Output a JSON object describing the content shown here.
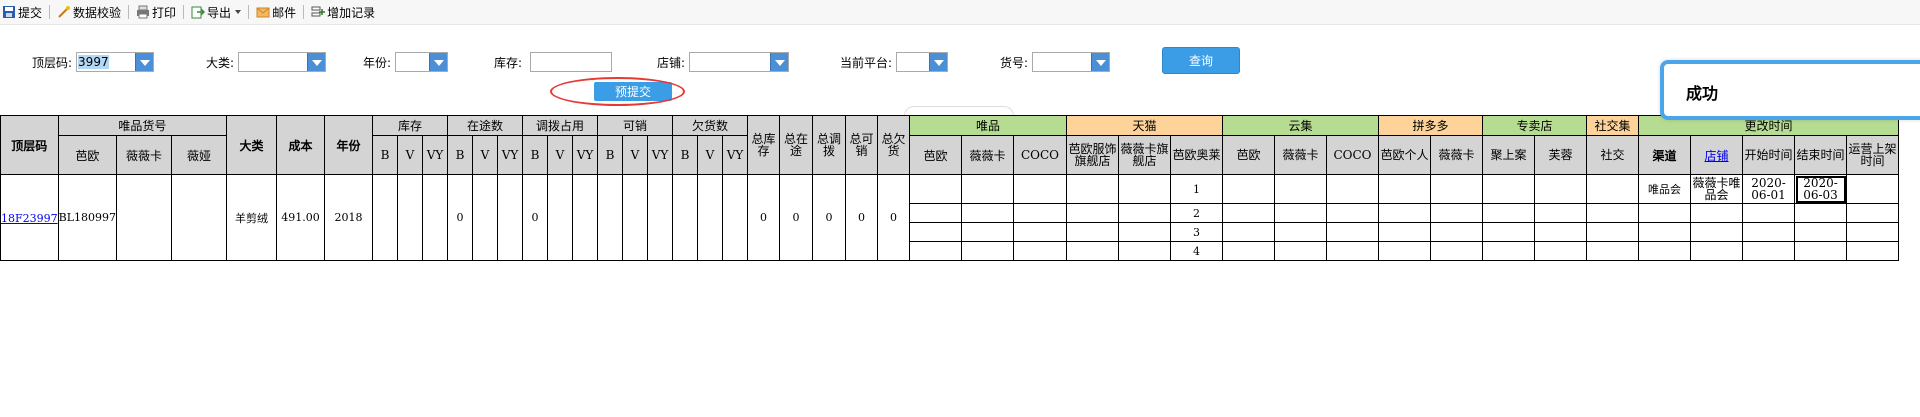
{
  "toolbar": {
    "submit": "提交",
    "validate": "数据校验",
    "print": "打印",
    "export": "导出",
    "mail": "邮件",
    "add_record": "增加记录"
  },
  "filters": {
    "top_code_label": "顶层码:",
    "top_code_value": "3997",
    "category_label": "大类:",
    "year_label": "年份:",
    "stock_label": "库存:",
    "shop_label": "店铺:",
    "platform_label": "当前平台:",
    "item_no_label": "货号:"
  },
  "buttons": {
    "query": "查询",
    "pre_submit": "预提交"
  },
  "toast": {
    "message": "成功"
  },
  "colors": {
    "accent": "#3b9de6",
    "header_green": "#b6dc92",
    "header_orange": "#fdd39a",
    "ellipse_red": "#e53935"
  },
  "table": {
    "h": {
      "top_code": "顶层码",
      "vip_item_no": "唯品货号",
      "baou": "芭欧",
      "weiweika": "薇薇卡",
      "weiya": "薇娅",
      "category": "大类",
      "cost": "成本",
      "year": "年份",
      "stock": "库存",
      "in_transit": "在途数",
      "transfer": "调拨占用",
      "sellable": "可销",
      "owed": "欠货数",
      "b": "B",
      "v": "V",
      "vy": "VY",
      "total_stock": "总库存",
      "total_transit": "总在途",
      "total_transfer": "总调拨",
      "total_sellable": "总可销",
      "total_owed": "总欠货",
      "vip": "唯品",
      "tmall": "天猫",
      "yunji": "云集",
      "pdd": "拼多多",
      "store": "专卖店",
      "social": "社交集",
      "change_time": "更改时间",
      "vip_baou": "芭欧",
      "vip_wwk": "薇薇卡",
      "vip_coco": "COCO",
      "tm_baou_flagship": "芭欧服饰旗舰店",
      "tm_wwk_flagship": "薇薇卡旗舰店",
      "tm_baou_outlet": "芭欧奥莱",
      "yj_baou": "芭欧",
      "yj_wwk": "薇薇卡",
      "yj_coco": "COCO",
      "pdd_baou_personal": "芭欧个人",
      "pdd_wwk": "薇薇卡",
      "st_jushang": "聚上案",
      "st_furong": "芙蓉",
      "so_social": "社交",
      "channel": "渠道",
      "shop": "店铺",
      "start_time": "开始时间",
      "end_time": "结束时间",
      "ops_listing_time": "运营上架时间"
    },
    "row": {
      "top_code": "18F23997",
      "vip_item_no": "BL180997",
      "category": "羊剪绒",
      "cost": "491.00",
      "year": "2018",
      "in_transit_b": "0",
      "transfer_b": "0",
      "total_stock": "0",
      "total_transit": "0",
      "total_transfer": "0",
      "total_sellable": "0",
      "total_owed": "0",
      "sub_nums": [
        "1",
        "2",
        "3",
        "4"
      ],
      "channel": "唯品会",
      "shop": "薇薇卡唯品会",
      "start_time": "2020-06-01",
      "end_time": "2020-06-03"
    }
  }
}
